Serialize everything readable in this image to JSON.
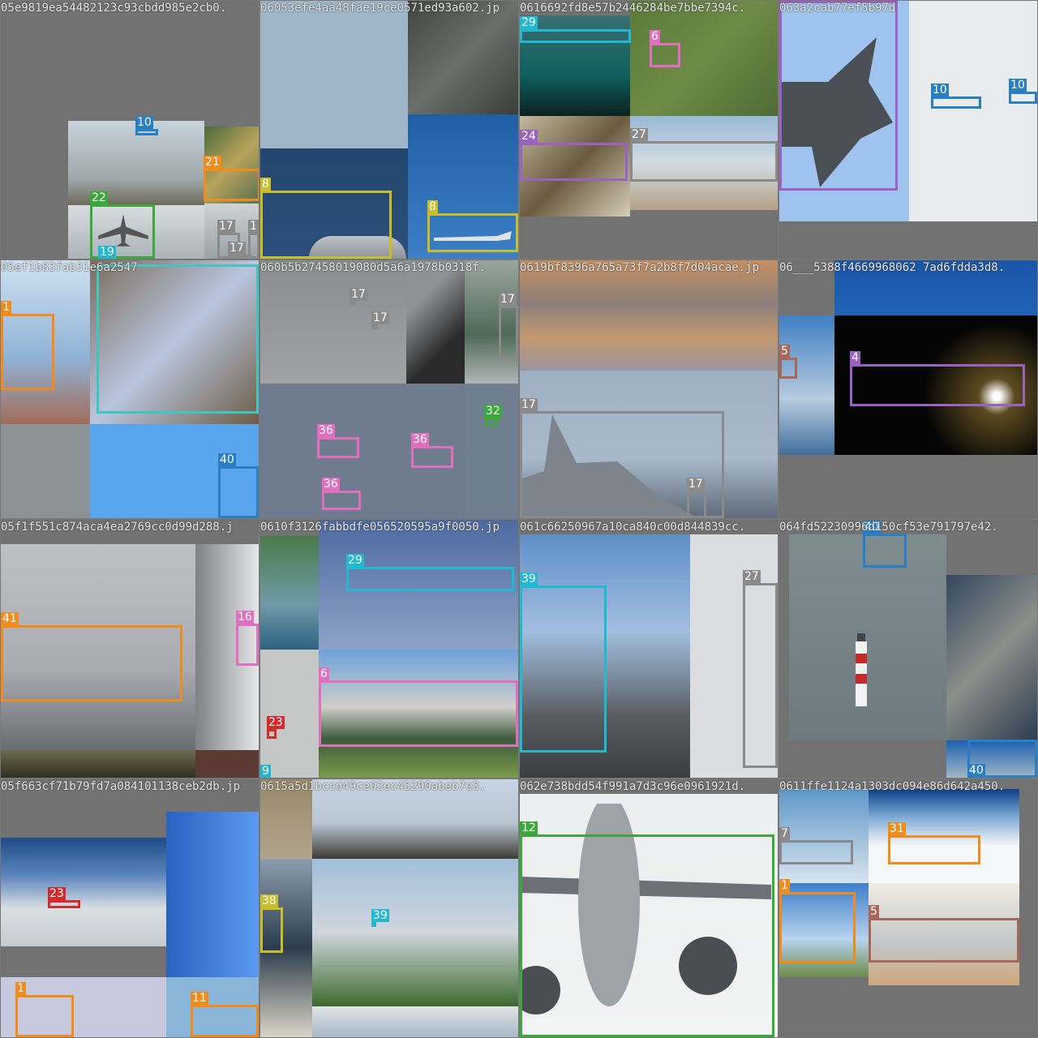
{
  "colors": {
    "orange": "#f08c1e",
    "blue": "#2a7fc2",
    "green": "#3aa83a",
    "cyan": "#22b8cf",
    "pink": "#e06fc0",
    "yellow": "#c8bd2c",
    "purple": "#9a62c2",
    "gray": "#8a8a8a",
    "brown": "#a8675a",
    "red": "#d42a2a",
    "teal": "#3fc6c0",
    "lightgreen": "#6cce4f"
  },
  "tiles": [
    {
      "name": "05e9819ea54482123c93cbdd985e2cb0.",
      "labels": [
        "10",
        "21",
        "22",
        "19",
        "17",
        "1",
        "17"
      ]
    },
    {
      "name": "06053efe4aa48fae19ce0571ed93a602.jp",
      "labels": [
        "8",
        "8"
      ]
    },
    {
      "name": "0616692fd8e57b2446284be7bbe7394c.",
      "labels": [
        "29",
        "6",
        "24",
        "27"
      ]
    },
    {
      "name": "063a2cab77ef5b97d",
      "labels": [
        "10",
        "10"
      ]
    },
    {
      "name": "05ef1b83fab31e6a2547",
      "labels": [
        "1",
        "40"
      ]
    },
    {
      "name": "060b5b27458019080d5a6a1978b0318f.",
      "labels": [
        "17",
        "17",
        "17",
        "32",
        "36",
        "36",
        "36"
      ]
    },
    {
      "name": "0619bf8396a765a73f7a2b8f7d04acae.jp",
      "labels": [
        "17",
        "17"
      ]
    },
    {
      "name": "06___5388f4669968062 7ad6fdda3d8.",
      "labels": [
        "5",
        "4"
      ]
    },
    {
      "name": "05f1f551c874aca4ea2769cc0d99d288.j",
      "labels": [
        "41",
        "16"
      ]
    },
    {
      "name": "0610f3126fabbdfe056520595a9f0050.jp",
      "labels": [
        "29",
        "6",
        "23",
        "9"
      ]
    },
    {
      "name": "061c66250967a10ca840c00d844839cc.",
      "labels": [
        "39",
        "27"
      ]
    },
    {
      "name": "064fd52230996d150cf53e791797e42.",
      "labels": [
        "40",
        "40"
      ]
    },
    {
      "name": "05f663cf71b79fd7a084101138ceb2db.jp",
      "labels": [
        "23",
        "1",
        "11"
      ]
    },
    {
      "name": "0615a5d1bccd49ce02ec45290abeb7e3.",
      "labels": [
        "38",
        "39"
      ]
    },
    {
      "name": "062e738bdd54f991a7d3c96e0961921d.",
      "labels": [
        "12"
      ]
    },
    {
      "name": "0611ffe1124a1303dc094e86d642a450.",
      "labels": [
        "7",
        "31",
        "1",
        "5"
      ]
    }
  ]
}
